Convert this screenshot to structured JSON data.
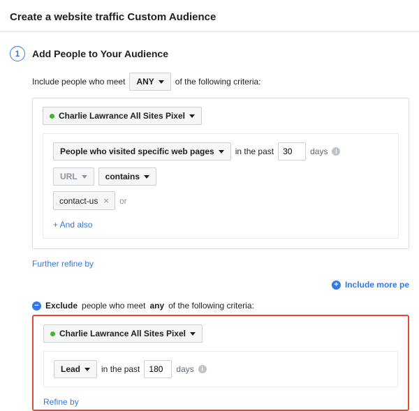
{
  "header": {
    "title": "Create a website traffic Custom Audience"
  },
  "step": {
    "number": "1",
    "title": "Add People to Your Audience"
  },
  "include": {
    "pre": "Include people who meet",
    "operator": "ANY",
    "post": "of the following criteria:",
    "pixel_name": "Charlie Lawrance All Sites Pixel",
    "event_label": "People who visited specific web pages",
    "in_the_past": "in the past",
    "days_value": "30",
    "days_label": "days",
    "url_label": "URL",
    "contains_label": "contains",
    "url_value": "contact-us",
    "or_label": "or",
    "and_also": "+ And also",
    "refine": "Further refine by"
  },
  "include_more": "Include more pe",
  "exclude": {
    "pre": "Exclude",
    "mid": "people who meet",
    "any": "any",
    "post": "of the following criteria:",
    "pixel_name": "Charlie Lawrance All Sites Pixel",
    "event_label": "Lead",
    "in_the_past": "in the past",
    "days_value": "180",
    "days_label": "days",
    "refine": "Refine by"
  }
}
